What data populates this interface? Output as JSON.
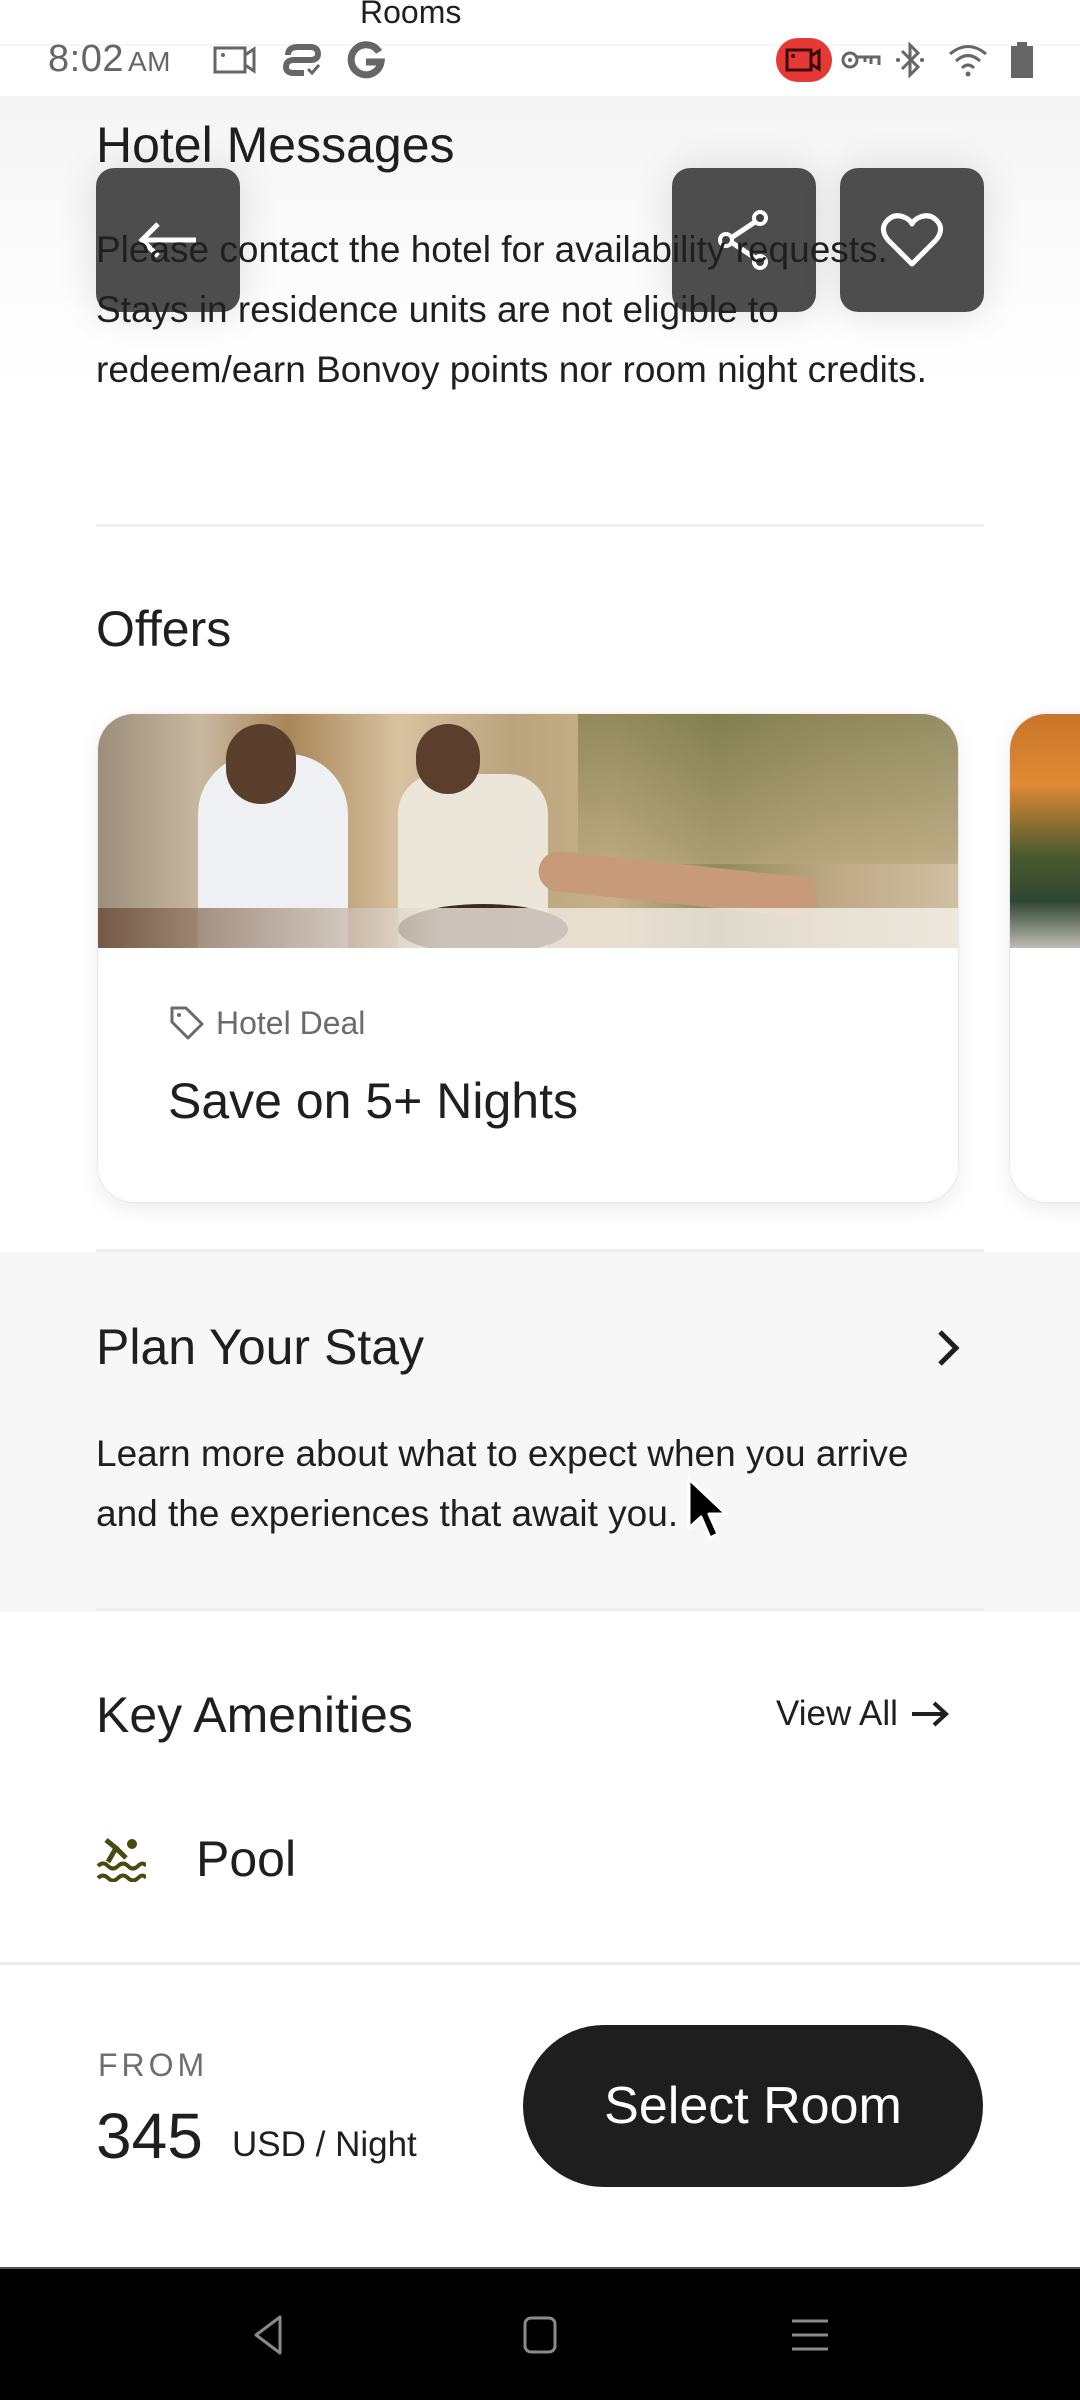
{
  "status_bar": {
    "overlay_title": "Rooms",
    "time": "8:02",
    "ampm": "AM",
    "left_icons": [
      "screen-record-icon",
      "cast-sync-icon",
      "google-icon"
    ],
    "right_icons": [
      "recording-indicator-icon",
      "vpn-key-icon",
      "bluetooth-icon",
      "wifi-icon",
      "battery-icon"
    ],
    "recording_color": "#e53935"
  },
  "header": {
    "back_label": "Back",
    "share_label": "Share",
    "favorite_label": "Favorite"
  },
  "hotel_messages": {
    "title": "Hotel Messages",
    "body": "Please contact the hotel for availability requests. Stays in residence units are not eligible to redeem/earn Bonvoy points nor room night credits."
  },
  "offers": {
    "title": "Offers",
    "items": [
      {
        "tag": "Hotel Deal",
        "name": "Save on 5+ Nights",
        "image_alt": "Two men relaxing on lounge chairs with drinks"
      },
      {
        "tag": "",
        "name": "",
        "image_alt": "Orange flowers in garden"
      }
    ]
  },
  "plan_your_stay": {
    "title": "Plan Your Stay",
    "body": "Learn more about what to expect when you arrive and the experiences that await you."
  },
  "key_amenities": {
    "title": "Key Amenities",
    "view_all": "View All",
    "items": [
      {
        "icon": "pool-icon",
        "label": "Pool",
        "icon_color": "#4a4a10"
      }
    ]
  },
  "booking": {
    "from_label": "FROM",
    "price": "345",
    "unit": "USD / Night",
    "select_room": "Select Room"
  },
  "nav_bar": {
    "buttons": [
      "back",
      "home",
      "recents"
    ]
  }
}
